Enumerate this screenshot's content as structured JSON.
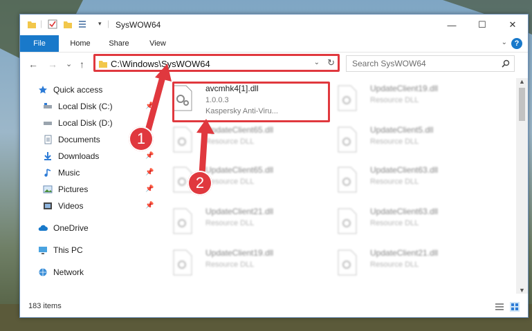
{
  "window": {
    "title": "SysWOW64"
  },
  "ribbon": {
    "tabs": [
      "File",
      "Home",
      "Share",
      "View"
    ],
    "help": "?"
  },
  "window_controls": {
    "minimize": "—",
    "maximize": "☐",
    "close": "✕"
  },
  "nav": {
    "back": "←",
    "forward": "→",
    "recent": "⌄",
    "up": "↑",
    "address": "C:\\Windows\\SysWOW64",
    "search_placeholder": "Search SysWOW64"
  },
  "sidebar": {
    "items": [
      {
        "label": "Quick access"
      },
      {
        "label": "Local Disk (C:)"
      },
      {
        "label": "Local Disk (D:)"
      },
      {
        "label": "Documents"
      },
      {
        "label": "Downloads"
      },
      {
        "label": "Music"
      },
      {
        "label": "Pictures"
      },
      {
        "label": "Videos"
      },
      {
        "label": "OneDrive"
      },
      {
        "label": "This PC"
      },
      {
        "label": "Network"
      }
    ]
  },
  "files": {
    "highlighted": {
      "name": "avcmhk4[1].dll",
      "version": "1.0.0.3",
      "company": "Kaspersky Anti-Viru..."
    },
    "left_col": [
      {
        "name": "UpdateClient65.dll",
        "desc": "Resource DLL"
      },
      {
        "name": "UpdateClient65.dll",
        "desc": "Resource DLL"
      },
      {
        "name": "UpdateClient21.dll",
        "desc": "Resource DLL"
      },
      {
        "name": "UpdateClient19.dll",
        "desc": "Resource DLL"
      }
    ],
    "right_col": [
      {
        "name": "UpdateClient19.dll",
        "desc": "Resource DLL"
      },
      {
        "name": "UpdateClient5.dll",
        "desc": "Resource DLL"
      },
      {
        "name": "UpdateClient63.dll",
        "desc": "Resource DLL"
      },
      {
        "name": "UpdateClient63.dll",
        "desc": "Resource DLL"
      },
      {
        "name": "UpdateClient21.dll",
        "desc": "Resource DLL"
      }
    ]
  },
  "status": {
    "items_count": "183 items"
  },
  "callouts": {
    "one": "1",
    "two": "2"
  },
  "colors": {
    "accent": "#1979ca",
    "highlight": "#e0383e",
    "selected": "#cce4f7"
  }
}
